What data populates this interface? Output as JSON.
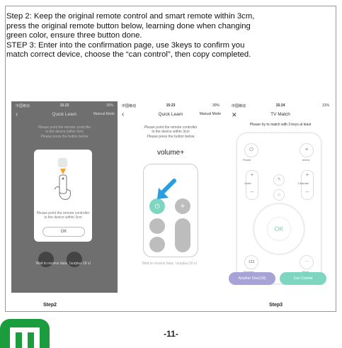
{
  "instructions": {
    "line1": "Step 2:  Keep the original remote control and smart remote within 3cm,",
    "line2": "press the original remote button below, learning done when changing",
    "line3": "green color, ensure three button done.",
    "line4": "STEP 3:  Enter into the confirmation page, use 3keys to confirm you",
    "line5": "match correct device, choose the “can control”,  then copy completed."
  },
  "phone1": {
    "status_left": "中国移动",
    "status_time": "15:22",
    "status_right": "30%",
    "title": "Quick Learn",
    "mode": "Manual Mode",
    "bg_text1": "Please point the remote controller",
    "bg_text2": "to the device within 3cm",
    "bg_text3": "Please press the button below",
    "dialog_text1": "Please point the remote controller",
    "dialog_text2": "to the device within 3cm",
    "ok": "OK",
    "wait": "Wait to receive data（surplus 18 s）"
  },
  "phone2": {
    "status_left": "中国移动",
    "status_time": "15:23",
    "status_right": "30%",
    "title": "Quick Learn",
    "mode": "Manual Mode",
    "text1": "Please point the remote controller",
    "text2": "to the device within 3cm",
    "text3": "Please press the button below",
    "key": "volume+",
    "wait": "Wait to receive data（surplus 20 s）"
  },
  "phone3": {
    "status_left": "中国移动",
    "status_time": "15:24",
    "status_right": "31%",
    "title": "TV Match",
    "subtitle": "Please try to match with 3 keys at least",
    "power": "Power",
    "menu": "menu",
    "voice": "Voice",
    "channel": "Channel",
    "ok": "OK",
    "number_key": "123",
    "number": "Number",
    "more": "More",
    "another": "Another One(1/0)",
    "can_control": "Can Control"
  },
  "captions": {
    "step2": "Step2",
    "step3": "Step3"
  },
  "page_number": "-11-",
  "colors": {
    "green": "#7fd6c0",
    "purple": "#a8a3d6",
    "arrow": "#2a9fe0",
    "logo": "#1b9d3e"
  }
}
